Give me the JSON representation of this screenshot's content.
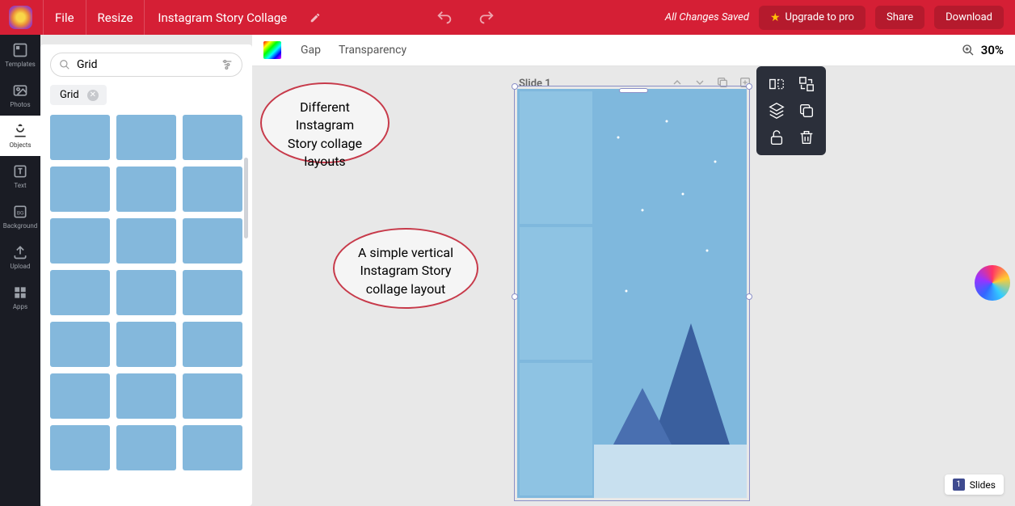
{
  "menu": {
    "file": "File",
    "resize": "Resize"
  },
  "doc_title": "Instagram Story Collage",
  "save_status": "All Changes Saved",
  "upgrade": "Upgrade to pro",
  "share": "Share",
  "download": "Download",
  "search_value": "Grid",
  "search_tag": "Grid",
  "rail": {
    "templates": "Templates",
    "photos": "Photos",
    "objects": "Objects",
    "text": "Text",
    "background": "Background",
    "upload": "Upload",
    "apps": "Apps"
  },
  "props": {
    "gap": "Gap",
    "transparency": "Transparency"
  },
  "zoom": "30%",
  "slide_label": "Slide 1",
  "callout1": "Different Instagram Story collage layouts",
  "callout2": "A simple vertical Instagram Story collage layout",
  "slides_footer": {
    "num": "1",
    "label": "Slides"
  }
}
